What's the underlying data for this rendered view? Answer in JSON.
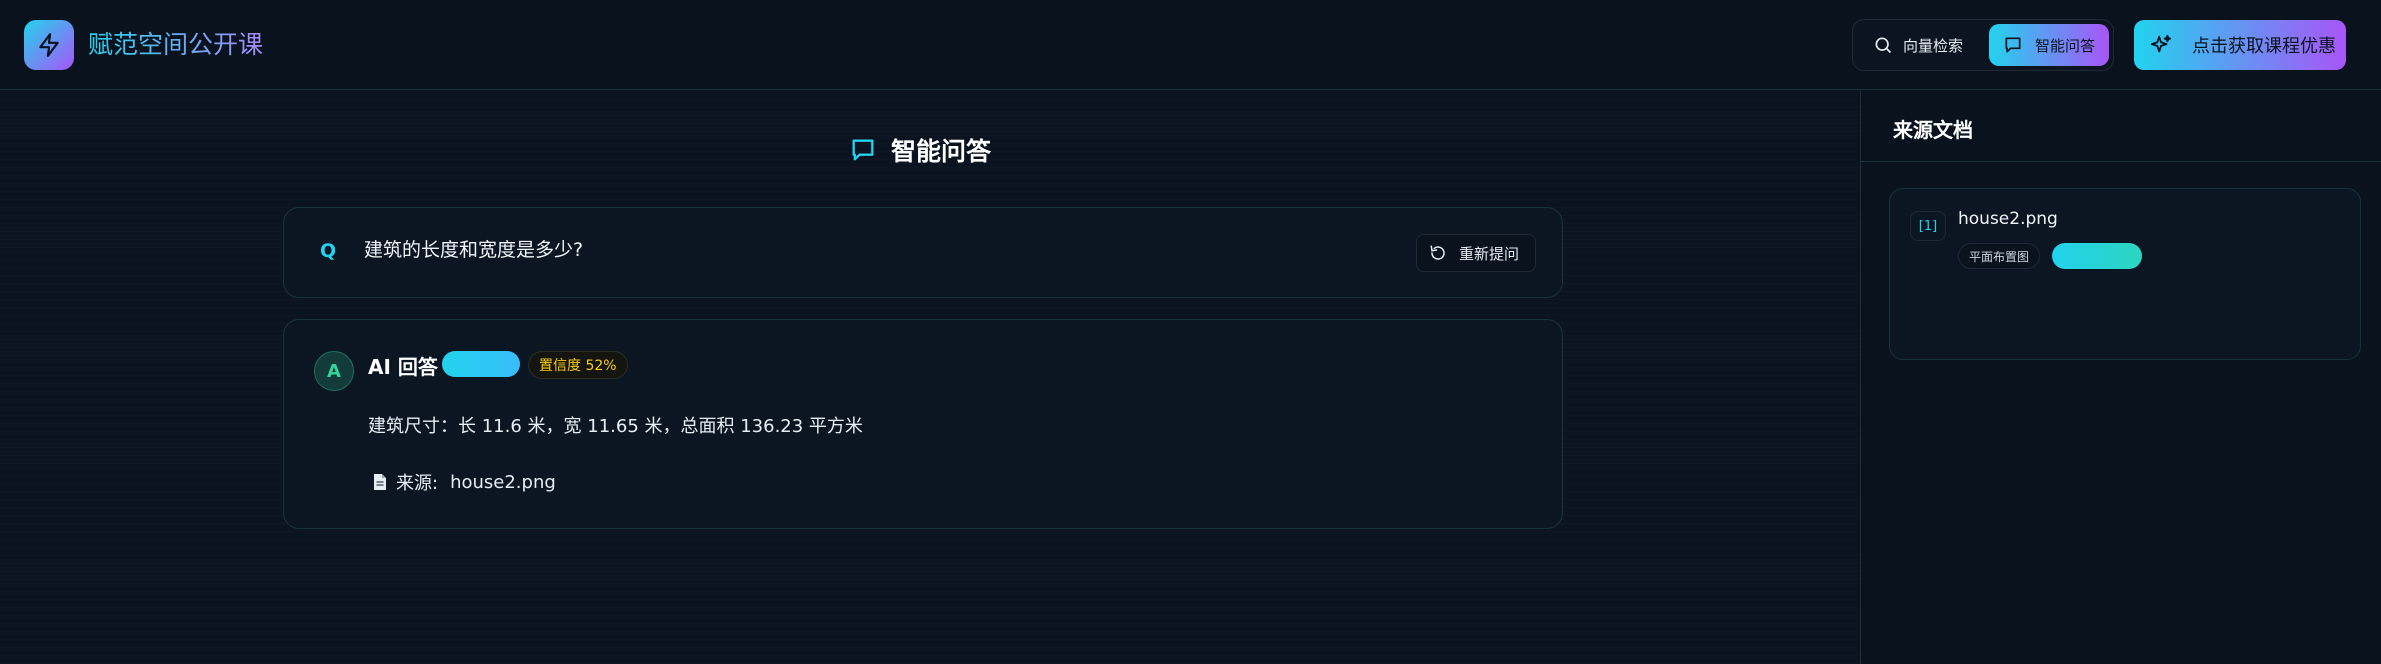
{
  "header": {
    "brand": "赋范空间公开课",
    "logo_icon": "lightning-icon",
    "mode_switch": {
      "vector_label": "向量检索",
      "qa_label": "智能问答",
      "active": "qa"
    },
    "promo_label": "点击获取课程优惠"
  },
  "main": {
    "title": "智能问答",
    "question": {
      "marker": "Q",
      "text": "建筑的长度和宽度是多少?",
      "reask_label": "重新提问"
    },
    "answer": {
      "avatar": "A",
      "title": "AI 回答",
      "confidence": "置信度 52%",
      "text": "建筑尺寸：长 11.6 米，宽 11.65 米，总面积 136.23 平方米",
      "source_label": "来源:",
      "source_file": "house2.png"
    }
  },
  "side_panel": {
    "title": "来源文档",
    "documents": [
      {
        "index": "[1]",
        "name": "house2.png",
        "tag": "平面布置图"
      }
    ]
  },
  "colors": {
    "accent_cyan": "#22d3ee",
    "accent_purple": "#a855f7",
    "background": "#0b1320",
    "confidence_yellow": "#facc15"
  }
}
